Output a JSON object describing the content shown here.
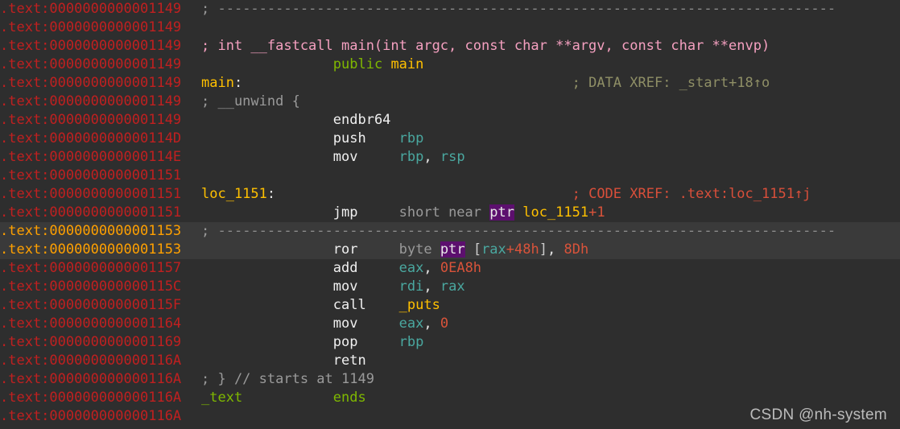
{
  "window": {
    "view": "IDA View-A disassembly",
    "segment": "_text",
    "background_color": "#2e2e2e",
    "highlight_row_color": "#3a3a3a",
    "selection_color": "#5c0f6e"
  },
  "colors": {
    "address": "#c02020",
    "address_highlight": "#ffa000",
    "comment": "#9a9a9a",
    "prototype_comment": "#f5a0c0",
    "data_xref": "#8f8f66",
    "code_xref": "#d94f3a",
    "keyword": "#7fb800",
    "name": "#ffc000",
    "mnemonic": "#f0f0f0",
    "register": "#4aa8a0",
    "number": "#d9533a",
    "modifier": "#9a9a9a"
  },
  "watermark": "CSDN @nh-system",
  "lines": [
    {
      "address": ".text:0000000000001149",
      "highlight": false,
      "tokens": [
        {
          "text": "; ",
          "cls": "t-cmt"
        },
        {
          "text": "---------------------------------------------------------------------------",
          "cls": "t-dash"
        }
      ]
    },
    {
      "address": ".text:0000000000001149",
      "highlight": false,
      "tokens": []
    },
    {
      "address": ".text:0000000000001149",
      "highlight": false,
      "tokens": [
        {
          "text": "; int __fastcall main(int argc, const char **argv, const char **envp)",
          "cls": "t-cmt-pink"
        }
      ]
    },
    {
      "address": ".text:0000000000001149",
      "highlight": false,
      "tokens": [
        {
          "text": "                ",
          "cls": "t-punct"
        },
        {
          "text": "public",
          "cls": "t-kw"
        },
        {
          "text": " ",
          "cls": "t-punct"
        },
        {
          "text": "main",
          "cls": "t-name"
        }
      ]
    },
    {
      "address": ".text:0000000000001149",
      "highlight": false,
      "tokens": [
        {
          "text": "main",
          "cls": "t-name"
        },
        {
          "text": ":",
          "cls": "t-punct"
        },
        {
          "text": "                                        ",
          "cls": "t-punct"
        },
        {
          "text": "; DATA XREF: _start+18↑o",
          "cls": "t-xref-d"
        }
      ]
    },
    {
      "address": ".text:0000000000001149",
      "highlight": false,
      "tokens": [
        {
          "text": "; __unwind {",
          "cls": "t-cmt"
        }
      ]
    },
    {
      "address": ".text:0000000000001149",
      "highlight": false,
      "tokens": [
        {
          "text": "                ",
          "cls": "t-punct"
        },
        {
          "text": "endbr64",
          "cls": "t-mnem"
        }
      ]
    },
    {
      "address": ".text:000000000000114D",
      "highlight": false,
      "tokens": [
        {
          "text": "                ",
          "cls": "t-punct"
        },
        {
          "text": "push    ",
          "cls": "t-mnem"
        },
        {
          "text": "rbp",
          "cls": "t-reg"
        }
      ]
    },
    {
      "address": ".text:000000000000114E",
      "highlight": false,
      "tokens": [
        {
          "text": "                ",
          "cls": "t-punct"
        },
        {
          "text": "mov     ",
          "cls": "t-mnem"
        },
        {
          "text": "rbp",
          "cls": "t-reg"
        },
        {
          "text": ", ",
          "cls": "t-punct"
        },
        {
          "text": "rsp",
          "cls": "t-reg"
        }
      ]
    },
    {
      "address": ".text:0000000000001151",
      "highlight": false,
      "tokens": []
    },
    {
      "address": ".text:0000000000001151",
      "highlight": false,
      "tokens": [
        {
          "text": "loc_1151",
          "cls": "t-name"
        },
        {
          "text": ":",
          "cls": "t-punct"
        },
        {
          "text": "                                    ",
          "cls": "t-punct"
        },
        {
          "text": "; CODE XREF: .text:loc_1151↑j",
          "cls": "t-xref-c"
        }
      ]
    },
    {
      "address": ".text:0000000000001151",
      "highlight": false,
      "tokens": [
        {
          "text": "                ",
          "cls": "t-punct"
        },
        {
          "text": "jmp     ",
          "cls": "t-mnem"
        },
        {
          "text": "short near ",
          "cls": "t-mod"
        },
        {
          "text": "ptr",
          "cls": "t-sel"
        },
        {
          "text": " ",
          "cls": "t-punct"
        },
        {
          "text": "loc_1151",
          "cls": "t-name"
        },
        {
          "text": "+1",
          "cls": "t-num"
        }
      ]
    },
    {
      "address": ".text:0000000000001153",
      "highlight": true,
      "tokens": [
        {
          "text": "; ",
          "cls": "t-cmt"
        },
        {
          "text": "---------------------------------------------------------------------------",
          "cls": "t-dash"
        }
      ]
    },
    {
      "address": ".text:0000000000001153",
      "highlight": true,
      "tokens": [
        {
          "text": "                ",
          "cls": "t-punct"
        },
        {
          "text": "ror     ",
          "cls": "t-mnem"
        },
        {
          "text": "byte ",
          "cls": "t-mod"
        },
        {
          "text": "ptr",
          "cls": "t-sel"
        },
        {
          "text": " ",
          "cls": "t-punct"
        },
        {
          "text": "[",
          "cls": "t-brk"
        },
        {
          "text": "rax",
          "cls": "t-reg"
        },
        {
          "text": "+48h",
          "cls": "t-num"
        },
        {
          "text": "]",
          "cls": "t-brk"
        },
        {
          "text": ", ",
          "cls": "t-punct"
        },
        {
          "text": "8Dh",
          "cls": "t-num"
        }
      ]
    },
    {
      "address": ".text:0000000000001157",
      "highlight": false,
      "tokens": [
        {
          "text": "                ",
          "cls": "t-punct"
        },
        {
          "text": "add     ",
          "cls": "t-mnem"
        },
        {
          "text": "eax",
          "cls": "t-reg"
        },
        {
          "text": ", ",
          "cls": "t-punct"
        },
        {
          "text": "0EA8h",
          "cls": "t-num"
        }
      ]
    },
    {
      "address": ".text:000000000000115C",
      "highlight": false,
      "tokens": [
        {
          "text": "                ",
          "cls": "t-punct"
        },
        {
          "text": "mov     ",
          "cls": "t-mnem"
        },
        {
          "text": "rdi",
          "cls": "t-reg"
        },
        {
          "text": ", ",
          "cls": "t-punct"
        },
        {
          "text": "rax",
          "cls": "t-reg"
        }
      ]
    },
    {
      "address": ".text:000000000000115F",
      "highlight": false,
      "tokens": [
        {
          "text": "                ",
          "cls": "t-punct"
        },
        {
          "text": "call    ",
          "cls": "t-mnem"
        },
        {
          "text": "_puts",
          "cls": "t-name"
        }
      ]
    },
    {
      "address": ".text:0000000000001164",
      "highlight": false,
      "tokens": [
        {
          "text": "                ",
          "cls": "t-punct"
        },
        {
          "text": "mov     ",
          "cls": "t-mnem"
        },
        {
          "text": "eax",
          "cls": "t-reg"
        },
        {
          "text": ", ",
          "cls": "t-punct"
        },
        {
          "text": "0",
          "cls": "t-num"
        }
      ]
    },
    {
      "address": ".text:0000000000001169",
      "highlight": false,
      "tokens": [
        {
          "text": "                ",
          "cls": "t-punct"
        },
        {
          "text": "pop     ",
          "cls": "t-mnem"
        },
        {
          "text": "rbp",
          "cls": "t-reg"
        }
      ]
    },
    {
      "address": ".text:000000000000116A",
      "highlight": false,
      "tokens": [
        {
          "text": "                ",
          "cls": "t-punct"
        },
        {
          "text": "retn",
          "cls": "t-mnem"
        }
      ]
    },
    {
      "address": ".text:000000000000116A",
      "highlight": false,
      "tokens": [
        {
          "text": "; } // starts at 1149",
          "cls": "t-cmt"
        }
      ]
    },
    {
      "address": ".text:000000000000116A",
      "highlight": false,
      "tokens": [
        {
          "text": "_text",
          "cls": "t-kw"
        },
        {
          "text": "           ",
          "cls": "t-punct"
        },
        {
          "text": "ends",
          "cls": "t-kw"
        }
      ]
    },
    {
      "address": ".text:000000000000116A",
      "highlight": false,
      "tokens": []
    }
  ]
}
